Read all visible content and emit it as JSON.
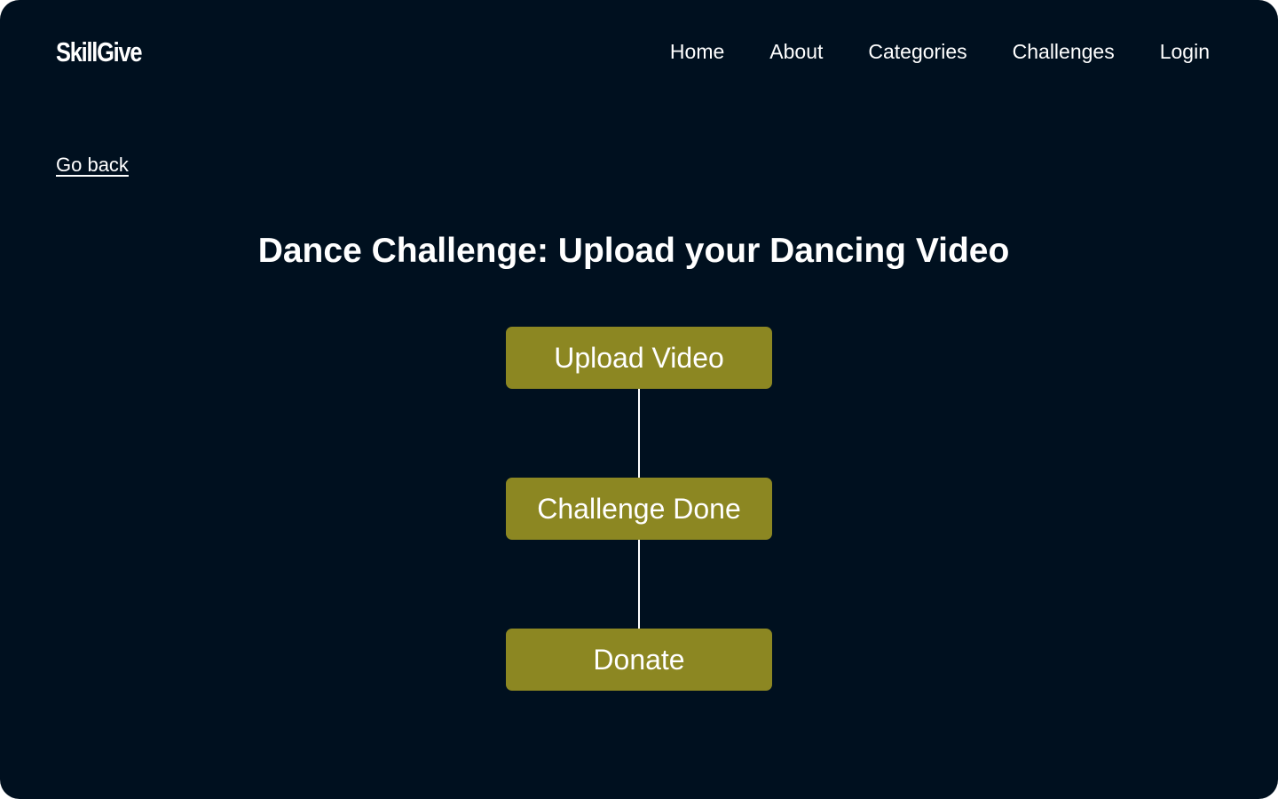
{
  "brand": {
    "logo_text": "SkillGive"
  },
  "nav": {
    "items": [
      {
        "label": "Home"
      },
      {
        "label": "About"
      },
      {
        "label": "Categories"
      },
      {
        "label": "Challenges"
      },
      {
        "label": "Login"
      }
    ]
  },
  "page": {
    "back_link": "Go back",
    "title": "Dance Challenge: Upload your Dancing Video"
  },
  "steps": [
    {
      "label": "Upload Video"
    },
    {
      "label": "Challenge Done"
    },
    {
      "label": "Donate"
    }
  ],
  "colors": {
    "background": "#00101f",
    "step_button": "#8c8722",
    "text": "#ffffff"
  }
}
